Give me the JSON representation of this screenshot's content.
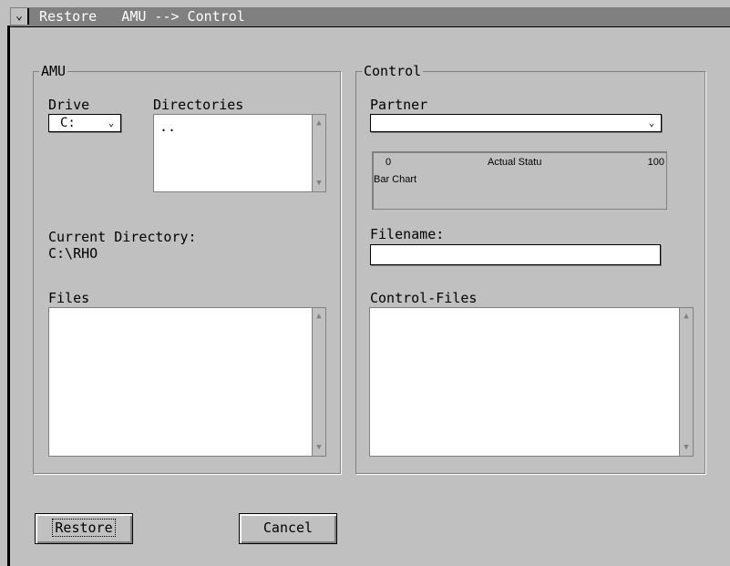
{
  "window": {
    "title": "Restore   AMU --> Control",
    "sysmenu_glyph": "⌄"
  },
  "amu": {
    "legend": "AMU",
    "drive_label": "Drive",
    "drive_value": "C:",
    "directories_label": "Directories",
    "directories_items": [
      ".."
    ],
    "current_dir_label": "Current Directory:",
    "current_dir_value": "C:\\RHO",
    "files_label": "Files"
  },
  "control": {
    "legend": "Control",
    "partner_label": "Partner",
    "partner_value": "",
    "bar_chart": {
      "min_label": "0",
      "title": "Actual Statu",
      "max_label": "100",
      "caption": "Bar Chart"
    },
    "filename_label": "Filename:",
    "filename_value": "",
    "control_files_label": "Control-Files"
  },
  "buttons": {
    "restore": "Restore",
    "cancel": "Cancel"
  },
  "glyphs": {
    "dropdown": "⌄",
    "scroll_up": "▲",
    "scroll_down": "▼"
  }
}
